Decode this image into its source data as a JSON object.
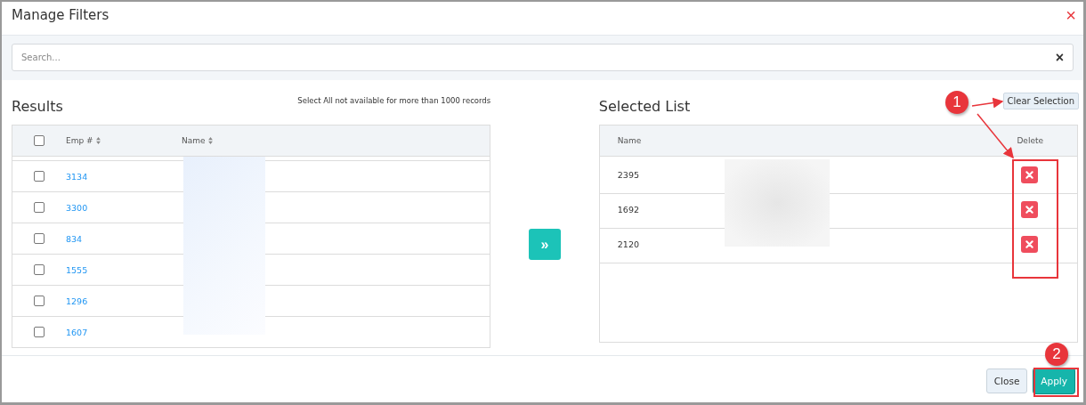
{
  "dialog": {
    "title": "Manage Filters",
    "close": "×"
  },
  "search": {
    "placeholder": "Search...",
    "clear": "×"
  },
  "results": {
    "title": "Results",
    "note": "Select All not available for more than 1000 records",
    "columns": [
      "Emp #",
      "Name"
    ],
    "select_all": {
      "checked": false
    },
    "rows": [
      {
        "emp": "3134",
        "checked": false
      },
      {
        "emp": "3300",
        "checked": false
      },
      {
        "emp": "834",
        "checked": false
      },
      {
        "emp": "1555",
        "checked": false
      },
      {
        "emp": "1296",
        "checked": false
      },
      {
        "emp": "1607",
        "checked": false
      }
    ]
  },
  "transfer": {
    "label": "»"
  },
  "selected_list": {
    "title": "Selected List",
    "clear_button": "Clear Selection",
    "columns": [
      "Name",
      "Delete"
    ],
    "rows": [
      {
        "id": "2395"
      },
      {
        "id": "1692"
      },
      {
        "id": "2120"
      }
    ]
  },
  "footer": {
    "buttons": [
      "Close",
      "Apply"
    ]
  },
  "annotations": [
    "1",
    "2"
  ]
}
